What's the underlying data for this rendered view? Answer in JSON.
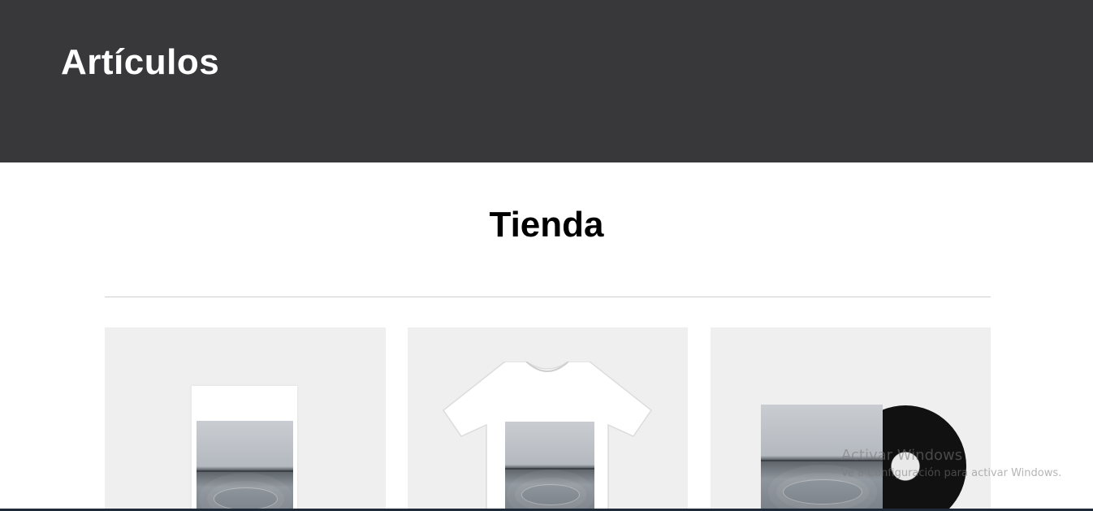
{
  "header": {
    "title": "Artículos",
    "background": "#38383a"
  },
  "section": {
    "title": "Tienda"
  },
  "products": [
    {
      "icon": "poster-image"
    },
    {
      "icon": "tshirt-image"
    },
    {
      "icon": "vinyl-record-image"
    }
  ],
  "watermark": {
    "title": "Activar Windows",
    "subtitle": "Ve a Configuración para activar Windows."
  }
}
